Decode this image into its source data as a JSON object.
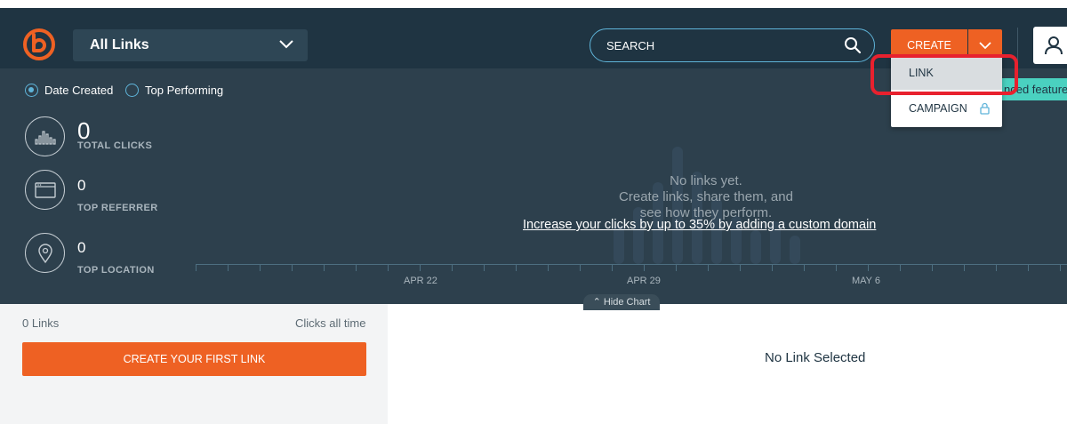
{
  "header": {
    "link_filter": "All Links",
    "search_placeholder": "SEARCH",
    "create_label": "CREATE"
  },
  "create_menu": {
    "items": [
      {
        "label": "LINK"
      },
      {
        "label": "CAMPAIGN"
      }
    ]
  },
  "dashboard": {
    "sort_options": [
      {
        "label": "Date Created",
        "selected": true
      },
      {
        "label": "Top Performing",
        "selected": false
      }
    ],
    "stats": [
      {
        "value": "0",
        "label": "TOTAL CLICKS"
      },
      {
        "value": "0",
        "label": "TOP REFERRER"
      },
      {
        "value": "0",
        "label": "TOP LOCATION"
      }
    ],
    "empty_lines": [
      "No links yet.",
      "Create links, share them, and",
      "see how they perform."
    ],
    "promo_link": "Increase your clicks by up to 35% by adding a custom domain",
    "axis_labels": [
      "APR 22",
      "APR 29",
      "MAY 6"
    ],
    "badge_text": "nced feature",
    "hide_chart": "Hide Chart"
  },
  "links_panel": {
    "count": "0 Links",
    "sort": "Clicks all time",
    "create_first": "CREATE YOUR FIRST LINK"
  },
  "detail": {
    "empty": "No Link Selected"
  },
  "colors": {
    "header_bg": "#1f3442",
    "dashboard_bg": "#2d404d",
    "accent_orange": "#ee6123",
    "accent_blue": "#5fb4d9",
    "badge_teal": "#4ad1c0",
    "highlight_red": "#e8212e"
  }
}
